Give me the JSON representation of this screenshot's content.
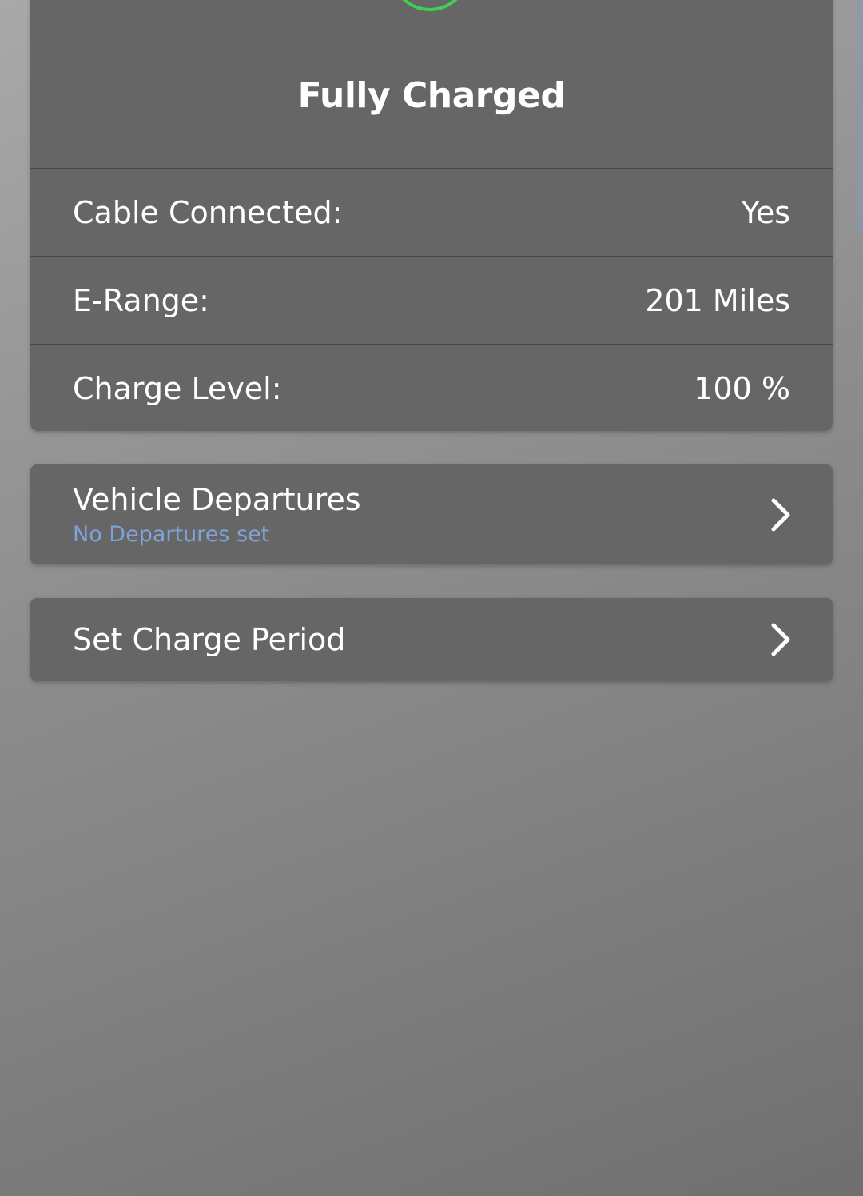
{
  "status": {
    "title": "Fully Charged",
    "icon": "charging-bolt-icon",
    "accent_color": "#3ecf54"
  },
  "details": [
    {
      "label": "Cable Connected:",
      "value": "Yes"
    },
    {
      "label": "E-Range:",
      "value": "201 Miles"
    },
    {
      "label": "Charge Level:",
      "value": "100 %"
    }
  ],
  "departures": {
    "title": "Vehicle Departures",
    "subtitle": "No Departures set",
    "icon": "chevron-right-icon"
  },
  "charge_period": {
    "title": "Set Charge Period",
    "icon": "chevron-right-icon"
  },
  "colors": {
    "card_bg": "#666666",
    "divider": "#4a4a4a",
    "text": "#ffffff",
    "subtitle": "#7fa3d6"
  }
}
